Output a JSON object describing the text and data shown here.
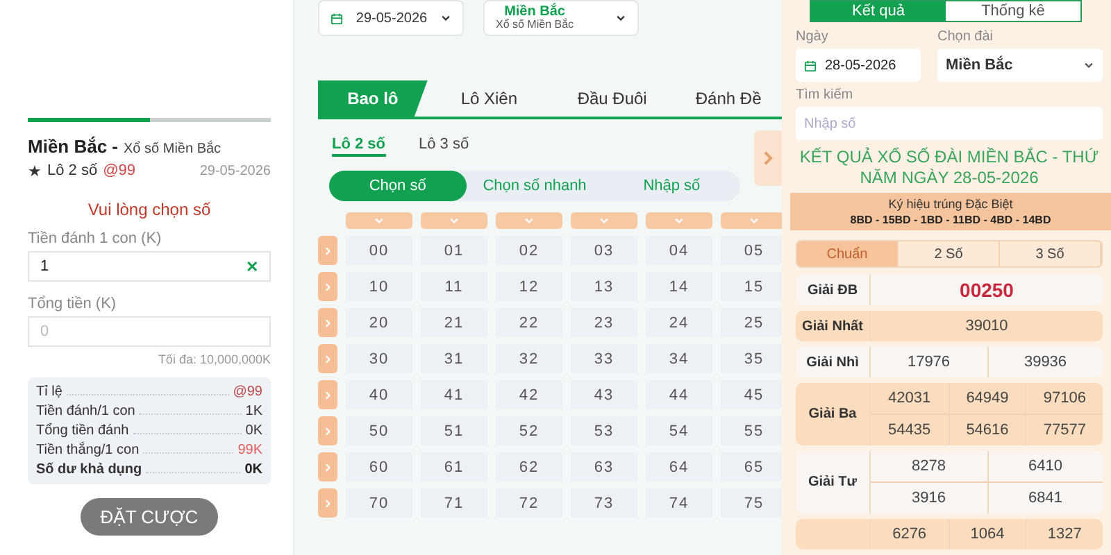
{
  "bet_slip": {
    "step": {
      "level": 0.5
    },
    "region": "Miền Bắc -",
    "region_sub": "Xổ số Miền Bắc",
    "star": "★",
    "bet_type": "Lô 2 số",
    "odds": "@99",
    "date": "29-05-2026",
    "notice": "Vui lòng chọn số",
    "stake_label": "Tiền đánh 1 con (K)",
    "stake_value": "1",
    "clear": "✕",
    "total_label": "Tổng tiền (K)",
    "total_placeholder": "0",
    "max_note": "Tối đa: 10,000,000K",
    "summary": [
      {
        "label": "Tỉ lệ",
        "value": "@99",
        "kind": "accent"
      },
      {
        "label": "Tiền đánh/1 con",
        "value": "1K",
        "kind": "normal"
      },
      {
        "label": "Tổng tiền đánh",
        "value": "0K",
        "kind": "normal"
      },
      {
        "label": "Tiền thắng/1 con",
        "value": "99K",
        "kind": "win"
      },
      {
        "label": "Số dư khả dụng",
        "value": "0K",
        "kind": "bold"
      }
    ],
    "submit": "ĐẶT CƯỢC"
  },
  "filters": {
    "date": "29-05-2026",
    "station": "Miền Bắc",
    "station_sub": "Xổ số Miền Bắc"
  },
  "game_tabs": [
    {
      "label": "Bao lô",
      "selected": true
    },
    {
      "label": "Lô Xiên",
      "selected": false
    },
    {
      "label": "Đầu Đuôi",
      "selected": false
    },
    {
      "label": "Đánh Đề",
      "selected": false
    }
  ],
  "sub_tabs": [
    {
      "label": "Lô 2 số",
      "selected": true
    },
    {
      "label": "Lô 3 số",
      "selected": false
    }
  ],
  "modes": [
    {
      "label": "Chọn số",
      "selected": true
    },
    {
      "label": "Chọn số nhanh",
      "selected": false
    },
    {
      "label": "Nhập số",
      "selected": false
    }
  ],
  "number_grid": [
    [
      "00",
      "01",
      "02",
      "03",
      "04",
      "05"
    ],
    [
      "10",
      "11",
      "12",
      "13",
      "14",
      "15"
    ],
    [
      "20",
      "21",
      "22",
      "23",
      "24",
      "25"
    ],
    [
      "30",
      "31",
      "32",
      "33",
      "34",
      "35"
    ],
    [
      "40",
      "41",
      "42",
      "43",
      "44",
      "45"
    ],
    [
      "50",
      "51",
      "52",
      "53",
      "54",
      "55"
    ],
    [
      "60",
      "61",
      "62",
      "63",
      "64",
      "65"
    ],
    [
      "70",
      "71",
      "72",
      "73",
      "74",
      "75"
    ]
  ],
  "results": {
    "tabs": [
      {
        "label": "Kết quả",
        "selected": true
      },
      {
        "label": "Thống kê",
        "selected": false
      }
    ],
    "date_label": "Ngày",
    "date": "28-05-2026",
    "station_label": "Chọn đài",
    "station": "Miền Bắc",
    "search_label": "Tìm kiếm",
    "search_placeholder": "Nhập số",
    "title": "KẾT QUẢ XỔ SỐ ĐÀI MIỀN BẮC - THỨ NĂM NGÀY 28-05-2026",
    "special_label": "Ký hiệu trúng Đặc Biệt",
    "special_codes": "8BD - 15BD - 1BD - 11BD - 4BD - 14BD",
    "views": [
      {
        "label": "Chuẩn",
        "selected": true
      },
      {
        "label": "2 Số",
        "selected": false
      },
      {
        "label": "3 Số",
        "selected": false
      }
    ],
    "prizes": [
      {
        "label": "Giải ĐB",
        "kind": "special",
        "rows": [
          [
            "00250"
          ]
        ]
      },
      {
        "label": "Giải Nhất",
        "kind": "normal",
        "rows": [
          [
            "39010"
          ]
        ]
      },
      {
        "label": "Giải Nhì",
        "kind": "normal",
        "rows": [
          [
            "17976",
            "39936"
          ]
        ]
      },
      {
        "label": "Giải Ba",
        "kind": "normal",
        "rows": [
          [
            "42031",
            "64949",
            "97106"
          ],
          [
            "54435",
            "54616",
            "77577"
          ]
        ]
      },
      {
        "label": "Giải Tư",
        "kind": "normal",
        "rows": [
          [
            "8278",
            "6410"
          ],
          [
            "3916",
            "6841"
          ]
        ]
      },
      {
        "kind": "normal",
        "rows": [
          [
            "6276",
            "1064",
            "1327"
          ]
        ]
      }
    ]
  }
}
